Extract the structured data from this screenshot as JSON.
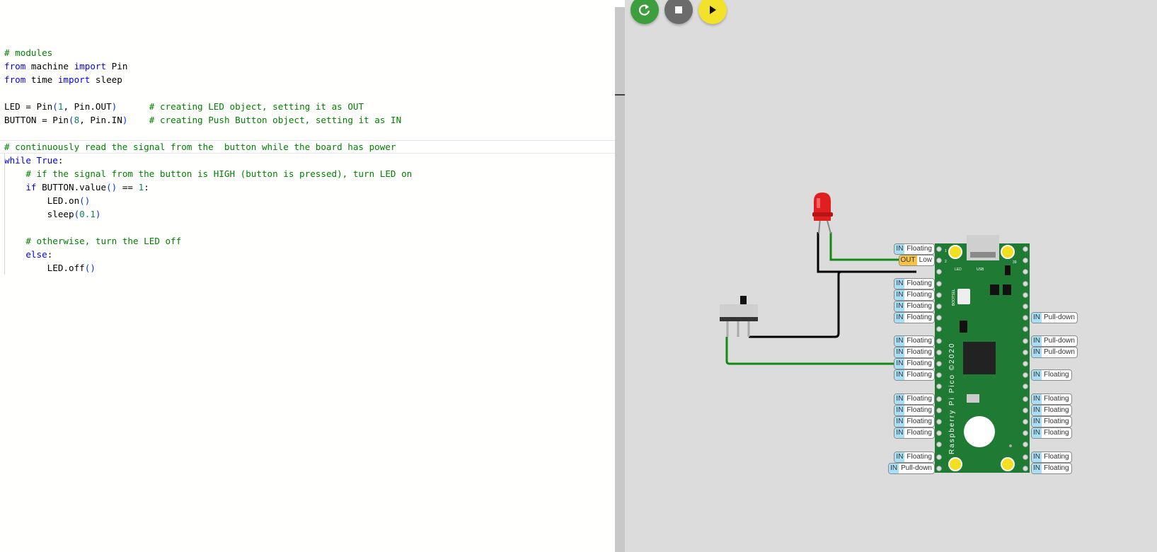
{
  "editor": {
    "lines": [
      [],
      [
        {
          "t": "# modules",
          "c": "comment"
        }
      ],
      [
        {
          "t": "from",
          "c": "keyword"
        },
        {
          "t": " machine ",
          "c": "plain"
        },
        {
          "t": "import",
          "c": "keyword"
        },
        {
          "t": " Pin",
          "c": "plain"
        }
      ],
      [
        {
          "t": "from",
          "c": "keyword"
        },
        {
          "t": " time ",
          "c": "plain"
        },
        {
          "t": "import",
          "c": "keyword"
        },
        {
          "t": " sleep",
          "c": "plain"
        }
      ],
      [],
      [
        {
          "t": "LED = Pin",
          "c": "plain"
        },
        {
          "t": "(",
          "c": "paren"
        },
        {
          "t": "1",
          "c": "number"
        },
        {
          "t": ", Pin.OUT",
          "c": "plain"
        },
        {
          "t": ")",
          "c": "paren"
        },
        {
          "t": "      ",
          "c": "plain"
        },
        {
          "t": "# creating LED object, setting it as OUT",
          "c": "comment"
        }
      ],
      [
        {
          "t": "BUTTON = Pin",
          "c": "plain"
        },
        {
          "t": "(",
          "c": "paren"
        },
        {
          "t": "8",
          "c": "number"
        },
        {
          "t": ", Pin.IN",
          "c": "plain"
        },
        {
          "t": ")",
          "c": "paren"
        },
        {
          "t": "    ",
          "c": "plain"
        },
        {
          "t": "# creating Push Button object, setting it as IN",
          "c": "comment"
        }
      ],
      [],
      [
        {
          "t": "# continuously read the signal from the  button while the board has power",
          "c": "comment"
        }
      ],
      [
        {
          "t": "while",
          "c": "keyword"
        },
        {
          "t": " ",
          "c": "plain"
        },
        {
          "t": "True",
          "c": "keyword"
        },
        {
          "t": ":",
          "c": "plain"
        }
      ],
      [
        {
          "t": "    ",
          "c": "plain"
        },
        {
          "t": "# if the signal from the button is HIGH (button is pressed), turn LED on",
          "c": "comment"
        }
      ],
      [
        {
          "t": "    ",
          "c": "plain"
        },
        {
          "t": "if",
          "c": "keyword"
        },
        {
          "t": " BUTTON.value",
          "c": "plain"
        },
        {
          "t": "()",
          "c": "paren"
        },
        {
          "t": " == ",
          "c": "plain"
        },
        {
          "t": "1",
          "c": "number"
        },
        {
          "t": ":",
          "c": "plain"
        }
      ],
      [
        {
          "t": "        LED.on",
          "c": "plain"
        },
        {
          "t": "()",
          "c": "paren"
        }
      ],
      [
        {
          "t": "        sleep",
          "c": "plain"
        },
        {
          "t": "(",
          "c": "paren"
        },
        {
          "t": "0.1",
          "c": "number"
        },
        {
          "t": ")",
          "c": "paren"
        }
      ],
      [],
      [
        {
          "t": "    ",
          "c": "plain"
        },
        {
          "t": "# otherwise, turn the LED off",
          "c": "comment"
        }
      ],
      [
        {
          "t": "    ",
          "c": "plain"
        },
        {
          "t": "else",
          "c": "keyword"
        },
        {
          "t": ":",
          "c": "plain"
        }
      ],
      [
        {
          "t": "        LED.off",
          "c": "plain"
        },
        {
          "t": "()",
          "c": "paren"
        }
      ]
    ]
  },
  "controls": [
    {
      "name": "restart-button",
      "icon": "restart-icon",
      "color": "#3c9e3c"
    },
    {
      "name": "stop-button",
      "icon": "stop-icon",
      "color": "#6b6b6b"
    },
    {
      "name": "run-button",
      "icon": "play-icon",
      "color": "#f2e22a"
    }
  ],
  "board": {
    "model": "Raspberry Pi Pico ©2020",
    "silkscreen": {
      "led": "LED",
      "usb": "USB",
      "bootsel": "BOOTSEL",
      "pin1": "1",
      "pin2": "2",
      "pin39": "39"
    },
    "left_pins": [
      {
        "mode": "IN",
        "state": "Floating"
      },
      {
        "mode": "OUT",
        "state": "Low"
      },
      {
        "mode": "IN",
        "state": "Floating"
      },
      {
        "mode": "IN",
        "state": "Floating"
      },
      {
        "mode": "IN",
        "state": "Floating"
      },
      {
        "mode": "IN",
        "state": "Floating"
      },
      {
        "mode": "IN",
        "state": "Floating"
      },
      {
        "mode": "IN",
        "state": "Floating"
      },
      {
        "mode": "IN",
        "state": "Floating"
      },
      {
        "mode": "IN",
        "state": "Floating"
      },
      {
        "mode": "IN",
        "state": "Floating"
      },
      {
        "mode": "IN",
        "state": "Floating"
      },
      {
        "mode": "IN",
        "state": "Floating"
      },
      {
        "mode": "IN",
        "state": "Floating"
      },
      {
        "mode": "IN",
        "state": "Floating"
      },
      {
        "mode": "IN",
        "state": "Pull-down"
      }
    ],
    "right_pins": [
      {
        "mode": "IN",
        "state": "Pull-down"
      },
      {
        "mode": "IN",
        "state": "Pull-down"
      },
      {
        "mode": "IN",
        "state": "Pull-down"
      },
      {
        "mode": "IN",
        "state": "Floating"
      },
      {
        "mode": "IN",
        "state": "Floating"
      },
      {
        "mode": "IN",
        "state": "Floating"
      },
      {
        "mode": "IN",
        "state": "Floating"
      },
      {
        "mode": "IN",
        "state": "Floating"
      },
      {
        "mode": "IN",
        "state": "Floating"
      },
      {
        "mode": "IN",
        "state": "Floating"
      }
    ]
  },
  "colors": {
    "pcb": "#1f7a33",
    "wire_signal": "#138a13",
    "wire_ground": "#000000",
    "led": "#e02020",
    "pad": "#f0e020"
  }
}
